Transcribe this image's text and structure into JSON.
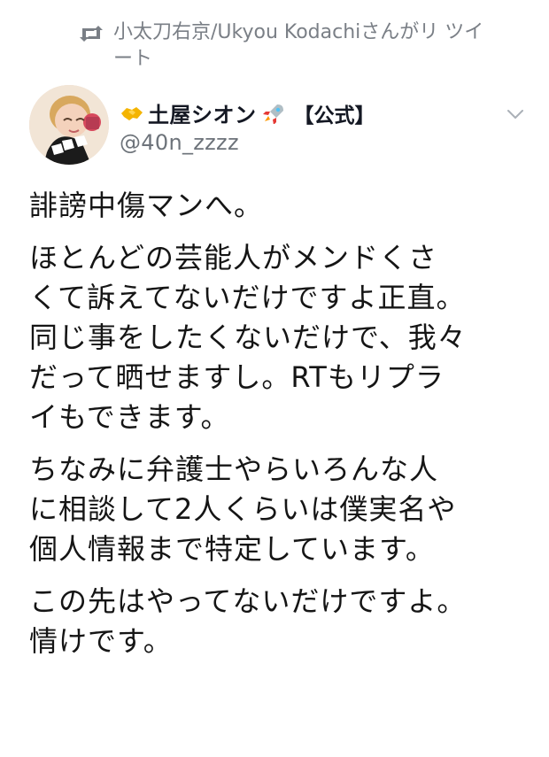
{
  "retweet": {
    "icon": "retweet-icon",
    "text": "小太刀右京/Ukyou Kodachiさんがリ\nツイート"
  },
  "author": {
    "avatar": "avatar",
    "leading_icon": "handshake-icon",
    "trailing_icon": "rocket-icon",
    "display_name": "土屋シオン",
    "badge": "【公式】",
    "handle": "@40n_zzzz"
  },
  "menu": {
    "icon": "chevron-down-icon"
  },
  "tweet": {
    "paragraphs": [
      "誹謗中傷マンへ。",
      "ほとんどの芸能人がメンドくさ\nくて訴えてないだけですよ正直。\n同じ事をしたくないだけで、我々\nだって晒せますし。RTもリプラ\nイもできます。",
      "ちなみに弁護士やらいろんな人\nに相談して2人くらいは僕実名や\n個人情報まで特定しています。",
      "この先はやってないだけですよ。\n情けです。"
    ]
  },
  "colors": {
    "text": "#151515",
    "secondary": "#7a7f86",
    "background": "#ffffff"
  }
}
